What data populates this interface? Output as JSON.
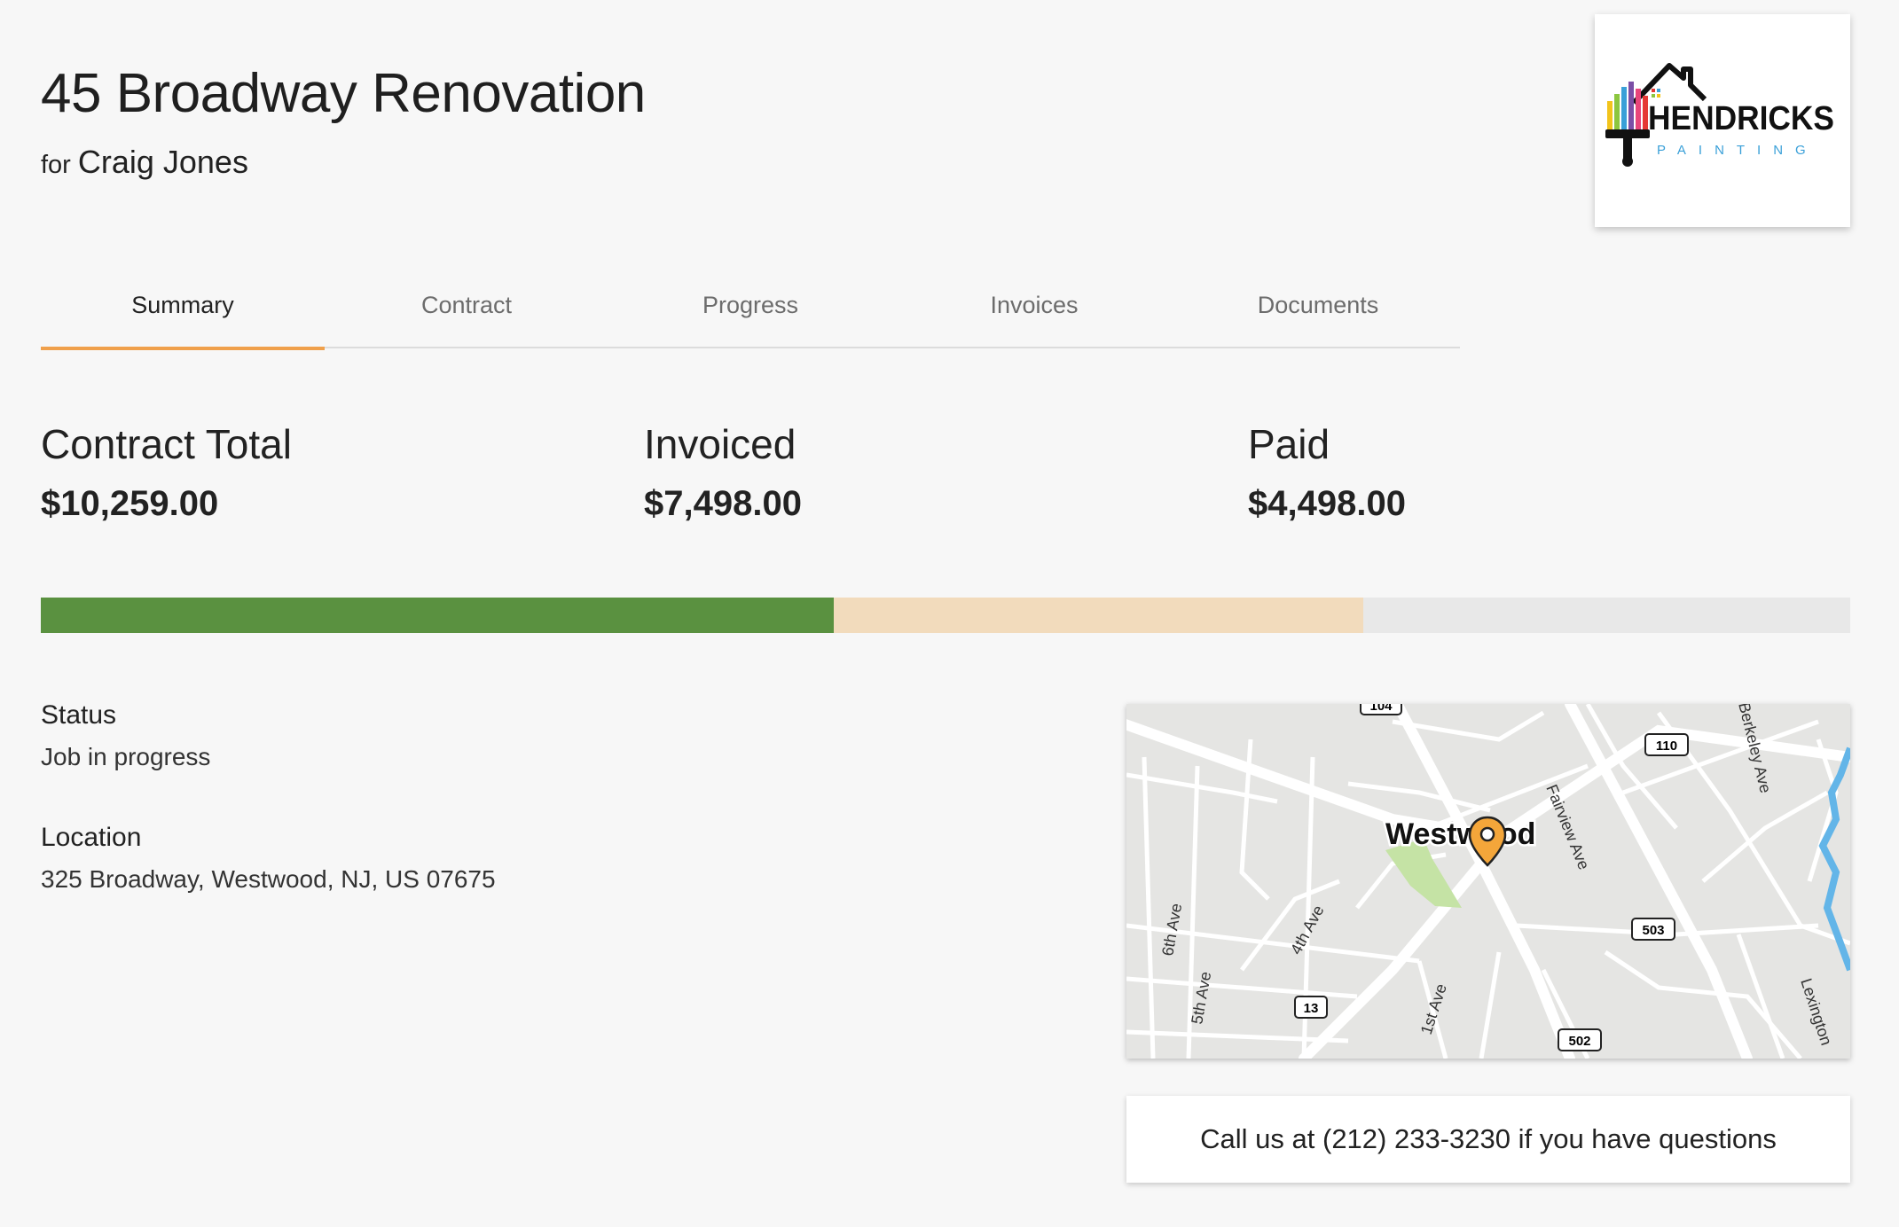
{
  "project": {
    "title": "45 Broadway Renovation",
    "for_label": "for",
    "client_name": "Craig Jones"
  },
  "logo": {
    "brand_word": "HENDRICKS",
    "sub_word": "PAINTING"
  },
  "tabs": [
    {
      "label": "Summary",
      "active": true
    },
    {
      "label": "Contract",
      "active": false
    },
    {
      "label": "Progress",
      "active": false
    },
    {
      "label": "Invoices",
      "active": false
    },
    {
      "label": "Documents",
      "active": false
    }
  ],
  "totals": {
    "contract_label": "Contract Total",
    "contract_value": "$10,259.00",
    "invoiced_label": "Invoiced",
    "invoiced_value": "$7,498.00",
    "paid_label": "Paid",
    "paid_value": "$4,498.00"
  },
  "progress": {
    "contract_total": 10259.0,
    "invoiced": 7498.0,
    "paid": 4498.0,
    "paid_color": "#5a9140",
    "invoiced_color": "#f2dbbc",
    "track_color": "#e8e8e8"
  },
  "status": {
    "label": "Status",
    "value": "Job in progress"
  },
  "location": {
    "label": "Location",
    "value": "325 Broadway, Westwood, NJ, US 07675"
  },
  "map": {
    "place_label": "Westwood",
    "streets": [
      "Fairview Ave",
      "Berkeley Ave",
      "6th Ave",
      "5th Ave",
      "4th Ave",
      "1st Ave",
      "Lexington"
    ],
    "route_shields": [
      "104",
      "110",
      "503",
      "13",
      "502"
    ],
    "pin_color": "#f4a63a"
  },
  "call_us": {
    "text": "Call us at (212) 233-3230 if you have questions"
  },
  "accent_color": "#f0a04b"
}
